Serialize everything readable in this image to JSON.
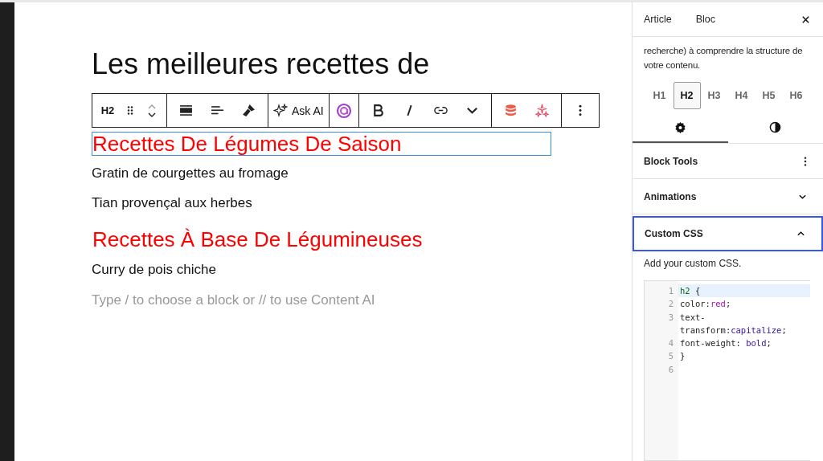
{
  "editor": {
    "title": "Les meilleures recettes de",
    "toolbar": {
      "block_type": "H2",
      "ask_ai": "Ask AI"
    },
    "blocks": [
      {
        "kind": "heading",
        "text": "Recettes De Légumes De Saison",
        "selected": true
      },
      {
        "kind": "paragraph",
        "text": "Gratin de courgettes au fromage",
        "selected": false
      },
      {
        "kind": "paragraph",
        "text": "Tian provençal aux herbes",
        "selected": false
      },
      {
        "kind": "heading",
        "text": "Recettes À Base De Légumineuses",
        "selected": false
      },
      {
        "kind": "paragraph",
        "text": "Curry de pois chiche",
        "selected": false
      }
    ],
    "placeholder": "Type / to choose a block or // to use Content AI"
  },
  "sidebar": {
    "tabs": [
      {
        "label": "Article"
      },
      {
        "label": "Bloc"
      }
    ],
    "description": "recherche) à comprendre la structure de votre contenu.",
    "levels": [
      {
        "label": "H1",
        "selected": false
      },
      {
        "label": "H2",
        "selected": true
      },
      {
        "label": "H3",
        "selected": false
      },
      {
        "label": "H4",
        "selected": false
      },
      {
        "label": "H5",
        "selected": false
      },
      {
        "label": "H6",
        "selected": false
      }
    ],
    "style_tabs": [
      {
        "kind": "settings",
        "selected": true
      },
      {
        "kind": "styles",
        "selected": false
      }
    ],
    "panels": [
      {
        "kind": "menu",
        "title": "Block Tools",
        "focused": false
      },
      {
        "kind": "toggle",
        "title": "Animations",
        "expanded": false,
        "focused": false
      },
      {
        "kind": "toggle",
        "title": "Custom CSS",
        "expanded": true,
        "focused": true
      }
    ],
    "custom_css": {
      "hint": "Add your custom CSS.",
      "lines": [
        {
          "number": "1",
          "active": true,
          "tokens": [
            {
              "kind": "tag",
              "text": "h2"
            },
            {
              "kind": "plain",
              "text": " {"
            }
          ]
        },
        {
          "number": "2",
          "active": false,
          "tokens": [
            {
              "kind": "plain",
              "text": "color:"
            },
            {
              "kind": "atom",
              "text": "red"
            },
            {
              "kind": "plain",
              "text": ";"
            }
          ]
        },
        {
          "number": "3",
          "active": false,
          "tokens": [
            {
              "kind": "plain",
              "text": "text-transform:"
            },
            {
              "kind": "value",
              "text": "capitalize"
            },
            {
              "kind": "plain",
              "text": ";"
            }
          ]
        },
        {
          "number": "4",
          "active": false,
          "tokens": [
            {
              "kind": "plain",
              "text": "font-weight: "
            },
            {
              "kind": "value",
              "text": "bold"
            },
            {
              "kind": "plain",
              "text": ";"
            }
          ]
        },
        {
          "number": "5",
          "active": false,
          "tokens": [
            {
              "kind": "plain",
              "text": "}"
            }
          ]
        },
        {
          "number": "6",
          "active": false
        }
      ]
    }
  }
}
